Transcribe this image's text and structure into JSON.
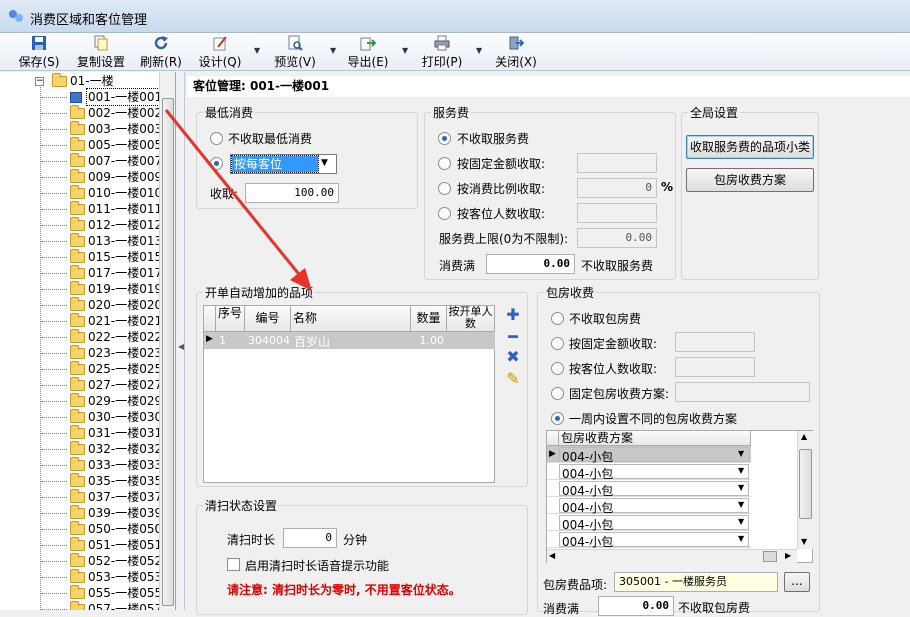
{
  "window": {
    "title": "消费区域和客位管理"
  },
  "toolbar": {
    "save": "保存(S)",
    "copy_settings": "复制设置",
    "refresh": "刷新(R)",
    "design": "设计(Q)",
    "preview": "预览(V)",
    "export": "导出(E)",
    "print": "打印(P)",
    "close": "关闭(X)"
  },
  "tree": {
    "root": "01-一楼",
    "items": [
      "001-一楼001",
      "002-一楼002",
      "003-一楼003",
      "005-一楼005",
      "007-一楼007",
      "009-一楼009",
      "010-一楼010",
      "011-一楼011",
      "012-一楼012",
      "013-一楼013",
      "015-一楼015",
      "017-一楼017",
      "019-一楼019",
      "020-一楼020",
      "021-一楼021",
      "022-一楼022",
      "023-一楼023",
      "025-一楼025",
      "027-一楼027",
      "029-一楼029",
      "030-一楼030",
      "031-一楼031",
      "032-一楼032",
      "033-一楼033",
      "035-一楼035",
      "037-一楼037",
      "039-一楼039",
      "050-一楼050",
      "051-一楼051",
      "052-一楼052",
      "053-一楼053",
      "055-一楼055",
      "057-一楼057"
    ],
    "selected_index": 0
  },
  "header": {
    "title": "客位管理: 001-一楼001"
  },
  "min_consume": {
    "title": "最低消费",
    "opt_none": "不收取最低消费",
    "opt_by_seat": "按每客位",
    "charge_label": "收取:",
    "charge_value": "100.00"
  },
  "service_fee": {
    "title": "服务费",
    "opt_none": "不收取服务费",
    "opt_fixed": "按固定金额收取:",
    "opt_ratio": "按消费比例收取:",
    "ratio_value": "0",
    "ratio_unit": "%",
    "opt_by_guest": "按客位人数收取:",
    "cap_label": "服务费上限(0为不限制):",
    "cap_value": "0.00",
    "threshold_label": "消费满",
    "threshold_value": "0.00",
    "threshold_suffix": "不收取服务费"
  },
  "global": {
    "title": "全局设置",
    "btn_service_items": "收取服务费的品项小类",
    "btn_room_plan": "包房收费方案"
  },
  "auto_items": {
    "title": "开单自动增加的品项",
    "columns": [
      "序号",
      "编号",
      "名称",
      "数量",
      "按开单人数"
    ],
    "rows": [
      {
        "seq": "1",
        "code": "304004",
        "name": "百岁山",
        "qty": "1.00",
        "by_guests": ""
      }
    ]
  },
  "room_fee": {
    "title": "包房收费",
    "opt_none": "不收取包房费",
    "opt_fixed": "按固定金额收取:",
    "opt_by_guest": "按客位人数收取:",
    "opt_plan": "固定包房收费方案:",
    "opt_weekly": "一周内设置不同的包房收费方案",
    "plan_header": "包房收费方案",
    "plans": [
      "004-小包",
      "004-小包",
      "004-小包",
      "004-小包",
      "004-小包",
      "004-小包"
    ],
    "item_label": "包房费品项:",
    "item_value": "305001 - 一楼服务员",
    "browse": "...",
    "threshold_label": "消费满",
    "threshold_value": "0.00",
    "threshold_suffix": "不收取包房费"
  },
  "cleaning": {
    "title": "清扫状态设置",
    "duration_label": "清扫时长",
    "duration_value": "0",
    "duration_unit": "分钟",
    "voice_label": "启用清扫时长语音提示功能",
    "note": "请注意: 清扫时长为零时, 不用置客位状态。"
  },
  "colors": {
    "accent": "#2c62c4",
    "warning": "#e00000",
    "annotation_arrow": "#e8322a",
    "selected_row": "#c8c8c8"
  }
}
